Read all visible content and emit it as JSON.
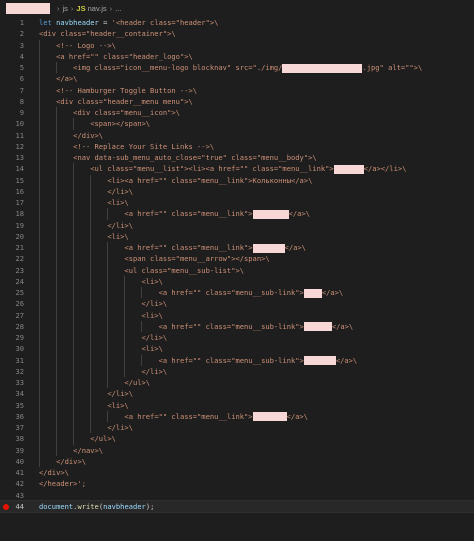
{
  "breadcrumb": {
    "items": [
      "js",
      "nav.js",
      "..."
    ],
    "file_badge": "JS"
  },
  "colors": {
    "background": "#1e1e1e",
    "keyword": "#569cd6",
    "variable": "#9cdcfe",
    "string": "#ce9178",
    "function": "#dcdcaa",
    "breakpoint": "#e51400",
    "redaction": "#f8d7d7"
  },
  "lines": [
    {
      "n": "1",
      "indent": 0,
      "segs": [
        [
          "kw",
          "let"
        ],
        [
          "plain",
          " "
        ],
        [
          "var",
          "navbheader"
        ],
        [
          "plain",
          " = "
        ],
        [
          "str",
          "'<header class=\"header\">\\"
        ]
      ]
    },
    {
      "n": "2",
      "indent": 0,
      "segs": [
        [
          "str",
          "<div class=\"header__container\">\\"
        ]
      ]
    },
    {
      "n": "3",
      "indent": 2,
      "segs": [
        [
          "str",
          "<!-- Logo -->\\"
        ]
      ]
    },
    {
      "n": "4",
      "indent": 2,
      "segs": [
        [
          "str",
          "<a href=\"\" class=\"header_logo\">\\"
        ]
      ]
    },
    {
      "n": "5",
      "indent": 4,
      "segs": [
        [
          "str",
          "<img class=\"icon__menu-logo blocknav\" src=\"./img/"
        ],
        [
          "redact",
          "",
          80
        ],
        [
          "str",
          ".jpg\" alt=\"\">\\"
        ]
      ]
    },
    {
      "n": "6",
      "indent": 2,
      "segs": [
        [
          "str",
          "</a>\\"
        ]
      ]
    },
    {
      "n": "7",
      "indent": 2,
      "segs": [
        [
          "str",
          "<!-- Hamburger Toggle Button -->\\"
        ]
      ]
    },
    {
      "n": "8",
      "indent": 2,
      "segs": [
        [
          "str",
          "<div class=\"header__menu menu\">\\"
        ]
      ]
    },
    {
      "n": "9",
      "indent": 4,
      "segs": [
        [
          "str",
          "<div class=\"menu__icon\">\\"
        ]
      ]
    },
    {
      "n": "10",
      "indent": 6,
      "segs": [
        [
          "str",
          "<span></span>\\"
        ]
      ]
    },
    {
      "n": "11",
      "indent": 4,
      "segs": [
        [
          "str",
          "</div>\\"
        ]
      ]
    },
    {
      "n": "12",
      "indent": 4,
      "segs": [
        [
          "str",
          "<!-- Replace Your Site Links -->\\"
        ]
      ]
    },
    {
      "n": "13",
      "indent": 4,
      "segs": [
        [
          "str",
          "<nav data-sub_menu_auto_close=\"true\" class=\"menu__body\">\\"
        ]
      ]
    },
    {
      "n": "14",
      "indent": 6,
      "segs": [
        [
          "str",
          "<ul class=\"menu__list\"><li><a href=\"\" class=\"menu__link\">"
        ],
        [
          "redact",
          "",
          30
        ],
        [
          "str",
          "</a></li>\\"
        ]
      ]
    },
    {
      "n": "15",
      "indent": 8,
      "segs": [
        [
          "str",
          "<li><a href=\"\" class=\"menu__link\">Кольконны</a>\\"
        ]
      ]
    },
    {
      "n": "16",
      "indent": 8,
      "segs": [
        [
          "str",
          "</li>\\"
        ]
      ]
    },
    {
      "n": "17",
      "indent": 8,
      "segs": [
        [
          "str",
          "<li>\\"
        ]
      ]
    },
    {
      "n": "18",
      "indent": 10,
      "segs": [
        [
          "str",
          "<a href=\"\" class=\"menu__link\">"
        ],
        [
          "redact",
          "",
          36
        ],
        [
          "str",
          "</a>\\"
        ]
      ]
    },
    {
      "n": "19",
      "indent": 8,
      "segs": [
        [
          "str",
          "</li>\\"
        ]
      ]
    },
    {
      "n": "20",
      "indent": 8,
      "segs": [
        [
          "str",
          "<li>\\"
        ]
      ]
    },
    {
      "n": "21",
      "indent": 10,
      "segs": [
        [
          "str",
          "<a href=\"\" class=\"menu__link\">"
        ],
        [
          "redact",
          "",
          32
        ],
        [
          "str",
          "</a>\\"
        ]
      ]
    },
    {
      "n": "22",
      "indent": 10,
      "segs": [
        [
          "str",
          "<span class=\"menu__arrow\"></span>\\"
        ]
      ]
    },
    {
      "n": "23",
      "indent": 10,
      "segs": [
        [
          "str",
          "<ul class=\"menu__sub-list\">\\"
        ]
      ]
    },
    {
      "n": "24",
      "indent": 12,
      "segs": [
        [
          "str",
          "<li>\\"
        ]
      ]
    },
    {
      "n": "25",
      "indent": 14,
      "segs": [
        [
          "str",
          "<a href=\"\" class=\"menu__sub-link\">"
        ],
        [
          "redact",
          "",
          18
        ],
        [
          "str",
          "</a>\\"
        ]
      ]
    },
    {
      "n": "26",
      "indent": 12,
      "segs": [
        [
          "str",
          "</li>\\"
        ]
      ]
    },
    {
      "n": "27",
      "indent": 12,
      "segs": [
        [
          "str",
          "<li>\\"
        ]
      ]
    },
    {
      "n": "28",
      "indent": 14,
      "segs": [
        [
          "str",
          "<a href=\"\" class=\"menu__sub-link\">"
        ],
        [
          "redact",
          "",
          28
        ],
        [
          "str",
          "</a>\\"
        ]
      ]
    },
    {
      "n": "29",
      "indent": 12,
      "segs": [
        [
          "str",
          "</li>\\"
        ]
      ]
    },
    {
      "n": "30",
      "indent": 12,
      "segs": [
        [
          "str",
          "<li>\\"
        ]
      ]
    },
    {
      "n": "31",
      "indent": 14,
      "segs": [
        [
          "str",
          "<a href=\"\" class=\"menu__sub-link\">"
        ],
        [
          "redact",
          "",
          32
        ],
        [
          "str",
          "</a>\\"
        ]
      ]
    },
    {
      "n": "32",
      "indent": 12,
      "segs": [
        [
          "str",
          "</li>\\"
        ]
      ]
    },
    {
      "n": "33",
      "indent": 10,
      "segs": [
        [
          "str",
          "</ul>\\"
        ]
      ]
    },
    {
      "n": "34",
      "indent": 8,
      "segs": [
        [
          "str",
          "</li>\\"
        ]
      ]
    },
    {
      "n": "35",
      "indent": 8,
      "segs": [
        [
          "str",
          "<li>\\"
        ]
      ]
    },
    {
      "n": "36",
      "indent": 10,
      "segs": [
        [
          "str",
          "<a href=\"\" class=\"menu__link\">"
        ],
        [
          "redact",
          "",
          34
        ],
        [
          "str",
          "</a>\\"
        ]
      ]
    },
    {
      "n": "37",
      "indent": 8,
      "segs": [
        [
          "str",
          "</li>\\"
        ]
      ]
    },
    {
      "n": "38",
      "indent": 6,
      "segs": [
        [
          "str",
          "</ul>\\"
        ]
      ]
    },
    {
      "n": "39",
      "indent": 4,
      "segs": [
        [
          "str",
          "</nav>\\"
        ]
      ]
    },
    {
      "n": "40",
      "indent": 2,
      "segs": [
        [
          "str",
          "</div>\\"
        ]
      ]
    },
    {
      "n": "41",
      "indent": 0,
      "segs": [
        [
          "str",
          "</div>\\"
        ]
      ]
    },
    {
      "n": "42",
      "indent": 0,
      "segs": [
        [
          "str",
          "</header>';"
        ]
      ]
    },
    {
      "n": "43",
      "indent": 0,
      "segs": []
    },
    {
      "n": "44",
      "indent": 0,
      "current": true,
      "breakpoint": true,
      "segs": [
        [
          "var",
          "document"
        ],
        [
          "plain",
          "."
        ],
        [
          "fn",
          "write"
        ],
        [
          "plain",
          "("
        ],
        [
          "var",
          "navbheader"
        ],
        [
          "plain",
          ");"
        ]
      ]
    }
  ]
}
